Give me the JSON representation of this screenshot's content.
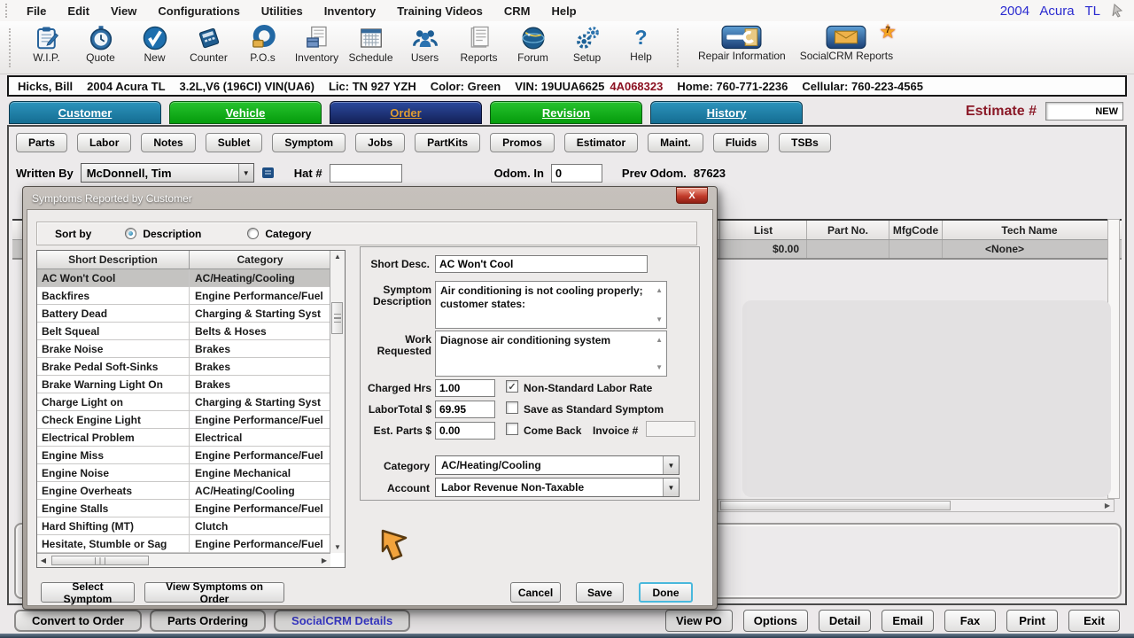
{
  "menu": {
    "items": [
      "File",
      "Edit",
      "View",
      "Configurations",
      "Utilities",
      "Inventory",
      "Training Videos",
      "CRM",
      "Help"
    ],
    "vehicle": "2004 Acura TL"
  },
  "toolbar": {
    "items": [
      "W.I.P.",
      "Quote",
      "New",
      "Counter",
      "P.O.s",
      "Inventory",
      "Schedule",
      "Users",
      "Reports",
      "Forum",
      "Setup",
      "Help"
    ],
    "repair_information": "Repair Information",
    "socialcrm_reports": "SocialCRM Reports",
    "socialcrm_badge": "7"
  },
  "customer_bar": {
    "name": "Hicks, Bill",
    "vehicle": "2004  Acura TL",
    "engine": "3.2L,V6 (196CI) VIN(UA6)",
    "license": "Lic: TN 927 YZH",
    "color": "Color: Green",
    "vin": "VIN: 19UUA6625",
    "vin_highlight": "4A068323",
    "home": "Home: 760-771-2236",
    "cellular": "Cellular: 760-223-4565"
  },
  "tabs": [
    {
      "label": "Customer",
      "cls": "teal"
    },
    {
      "label": "Vehicle",
      "cls": "green"
    },
    {
      "label": "Order",
      "cls": "navy"
    },
    {
      "label": "Revision",
      "cls": "green"
    },
    {
      "label": "History",
      "cls": "teal"
    }
  ],
  "estimate": {
    "label": "Estimate #",
    "value": "NEW"
  },
  "subtabs": [
    "Parts",
    "Labor",
    "Notes",
    "Sublet",
    "Symptom",
    "Jobs",
    "PartKits",
    "Promos",
    "Estimator",
    "Maint.",
    "Fluids",
    "TSBs"
  ],
  "order_header": {
    "written_by_label": "Written By",
    "written_by_value": "McDonnell, Tim",
    "hat_label": "Hat #",
    "hat_value": "",
    "odom_in_label": "Odom. In",
    "odom_in_value": "0",
    "prev_odom_label": "Prev Odom.",
    "prev_odom_value": "87623"
  },
  "parts_grid": {
    "columns": [
      "List",
      "Part No.",
      "MfgCode",
      "Tech Name"
    ],
    "row": {
      "list": "$0.00",
      "part_no": "",
      "mfg_code": "",
      "tech_name": "<None>"
    }
  },
  "dialog": {
    "title": "Symptoms Reported by Customer",
    "close_label": "X",
    "sort_by": {
      "label": "Sort by",
      "options": [
        {
          "label": "Description",
          "selected": true
        },
        {
          "label": "Category",
          "selected": false
        }
      ]
    },
    "table": {
      "columns": [
        "Short Description",
        "Category"
      ],
      "rows": [
        {
          "desc": "AC Won't Cool",
          "cat": "AC/Heating/Cooling",
          "cls": "selected"
        },
        {
          "desc": "Backfires",
          "cat": "Engine Performance/Fuel"
        },
        {
          "desc": "Battery Dead",
          "cat": "Charging & Starting Syst"
        },
        {
          "desc": "Belt Squeal",
          "cat": "Belts & Hoses"
        },
        {
          "desc": "Brake Noise",
          "cat": "Brakes"
        },
        {
          "desc": "Brake Pedal Soft-Sinks",
          "cat": "Brakes"
        },
        {
          "desc": "Brake Warning Light On",
          "cat": "Brakes"
        },
        {
          "desc": "Charge Light on",
          "cat": "Charging & Starting Syst"
        },
        {
          "desc": "Check Engine Light",
          "cat": "Engine Performance/Fuel"
        },
        {
          "desc": "Electrical Problem",
          "cat": "Electrical"
        },
        {
          "desc": "Engine Miss",
          "cat": "Engine Performance/Fuel"
        },
        {
          "desc": "Engine Noise",
          "cat": "Engine Mechanical"
        },
        {
          "desc": "Engine Overheats",
          "cat": "AC/Heating/Cooling"
        },
        {
          "desc": "Engine Stalls",
          "cat": "Engine Performance/Fuel"
        },
        {
          "desc": "Hard Shifting (MT)",
          "cat": "Clutch"
        },
        {
          "desc": "Hesitate, Stumble or Sag",
          "cat": "Engine Performance/Fuel"
        }
      ]
    },
    "fields": {
      "short_desc_label": "Short Desc.",
      "short_desc": "AC Won't Cool",
      "symptom_desc_label": "Symptom Description",
      "symptom_desc": "Air conditioning is not cooling properly; customer states:",
      "work_requested_label": "Work Requested",
      "work_requested": "Diagnose air conditioning system",
      "charged_hrs_label": "Charged Hrs",
      "charged_hrs": "1.00",
      "labor_total_label": "LaborTotal $",
      "labor_total": "69.95",
      "est_parts_label": "Est. Parts $",
      "est_parts": "0.00",
      "non_standard_label": "Non-Standard Labor Rate",
      "save_standard_label": "Save as Standard Symptom",
      "come_back_label": "Come Back",
      "invoice_label": "Invoice #",
      "invoice_value": "",
      "category_label": "Category",
      "category_value": "AC/Heating/Cooling",
      "account_label": "Account",
      "account_value": "Labor Revenue Non-Taxable"
    },
    "buttons": {
      "select_symptom": "Select Symptom",
      "view_symptoms": "View Symptoms on Order",
      "cancel": "Cancel",
      "save": "Save",
      "done": "Done"
    }
  },
  "bottom_bar": {
    "left": [
      {
        "label": "Convert to Order"
      },
      {
        "label": "Parts Ordering"
      },
      {
        "label": "SocialCRM Details",
        "cls": "blue"
      }
    ],
    "right": [
      "View PO",
      "Options",
      "Detail",
      "Email",
      "Fax",
      "Print",
      "Exit"
    ]
  }
}
